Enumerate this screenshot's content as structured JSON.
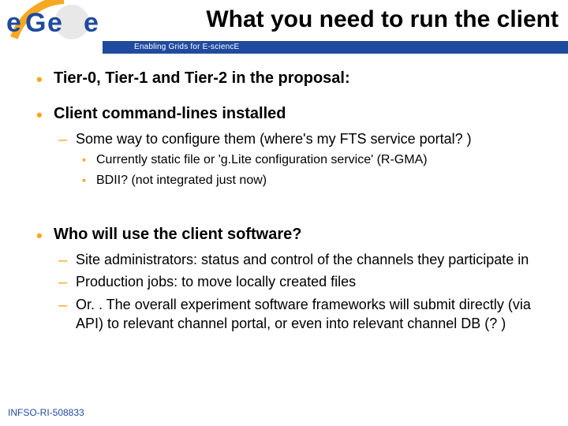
{
  "header": {
    "title": "What you need to run the client",
    "subtitle": "Enabling Grids for E-sciencE",
    "logo": {
      "brand_text": "eGee",
      "arc_color": "#f7a823",
      "primary_color": "#1f4a9e"
    }
  },
  "bullets": [
    {
      "text": "Tier-0, Tier-1 and Tier-2 in the proposal:"
    },
    {
      "text": "Client command-lines installed",
      "sub": [
        {
          "text": "Some way to configure them (where's my FTS service portal? )",
          "sub": [
            {
              "text": "Currently static file or 'g.Lite configuration service' (R-GMA)"
            },
            {
              "text": "BDII? (not integrated just now)"
            }
          ]
        }
      ]
    },
    {
      "text": "Who will use the client software?",
      "sub": [
        {
          "text": "Site administrators: status and control of the channels they participate in"
        },
        {
          "text": "Production jobs: to move locally created files"
        },
        {
          "text": "Or. . The overall experiment software frameworks will submit directly (via API) to relevant channel portal, or even into relevant channel DB (? )"
        }
      ]
    }
  ],
  "footer": {
    "ref": "INFSO-RI-508833"
  }
}
